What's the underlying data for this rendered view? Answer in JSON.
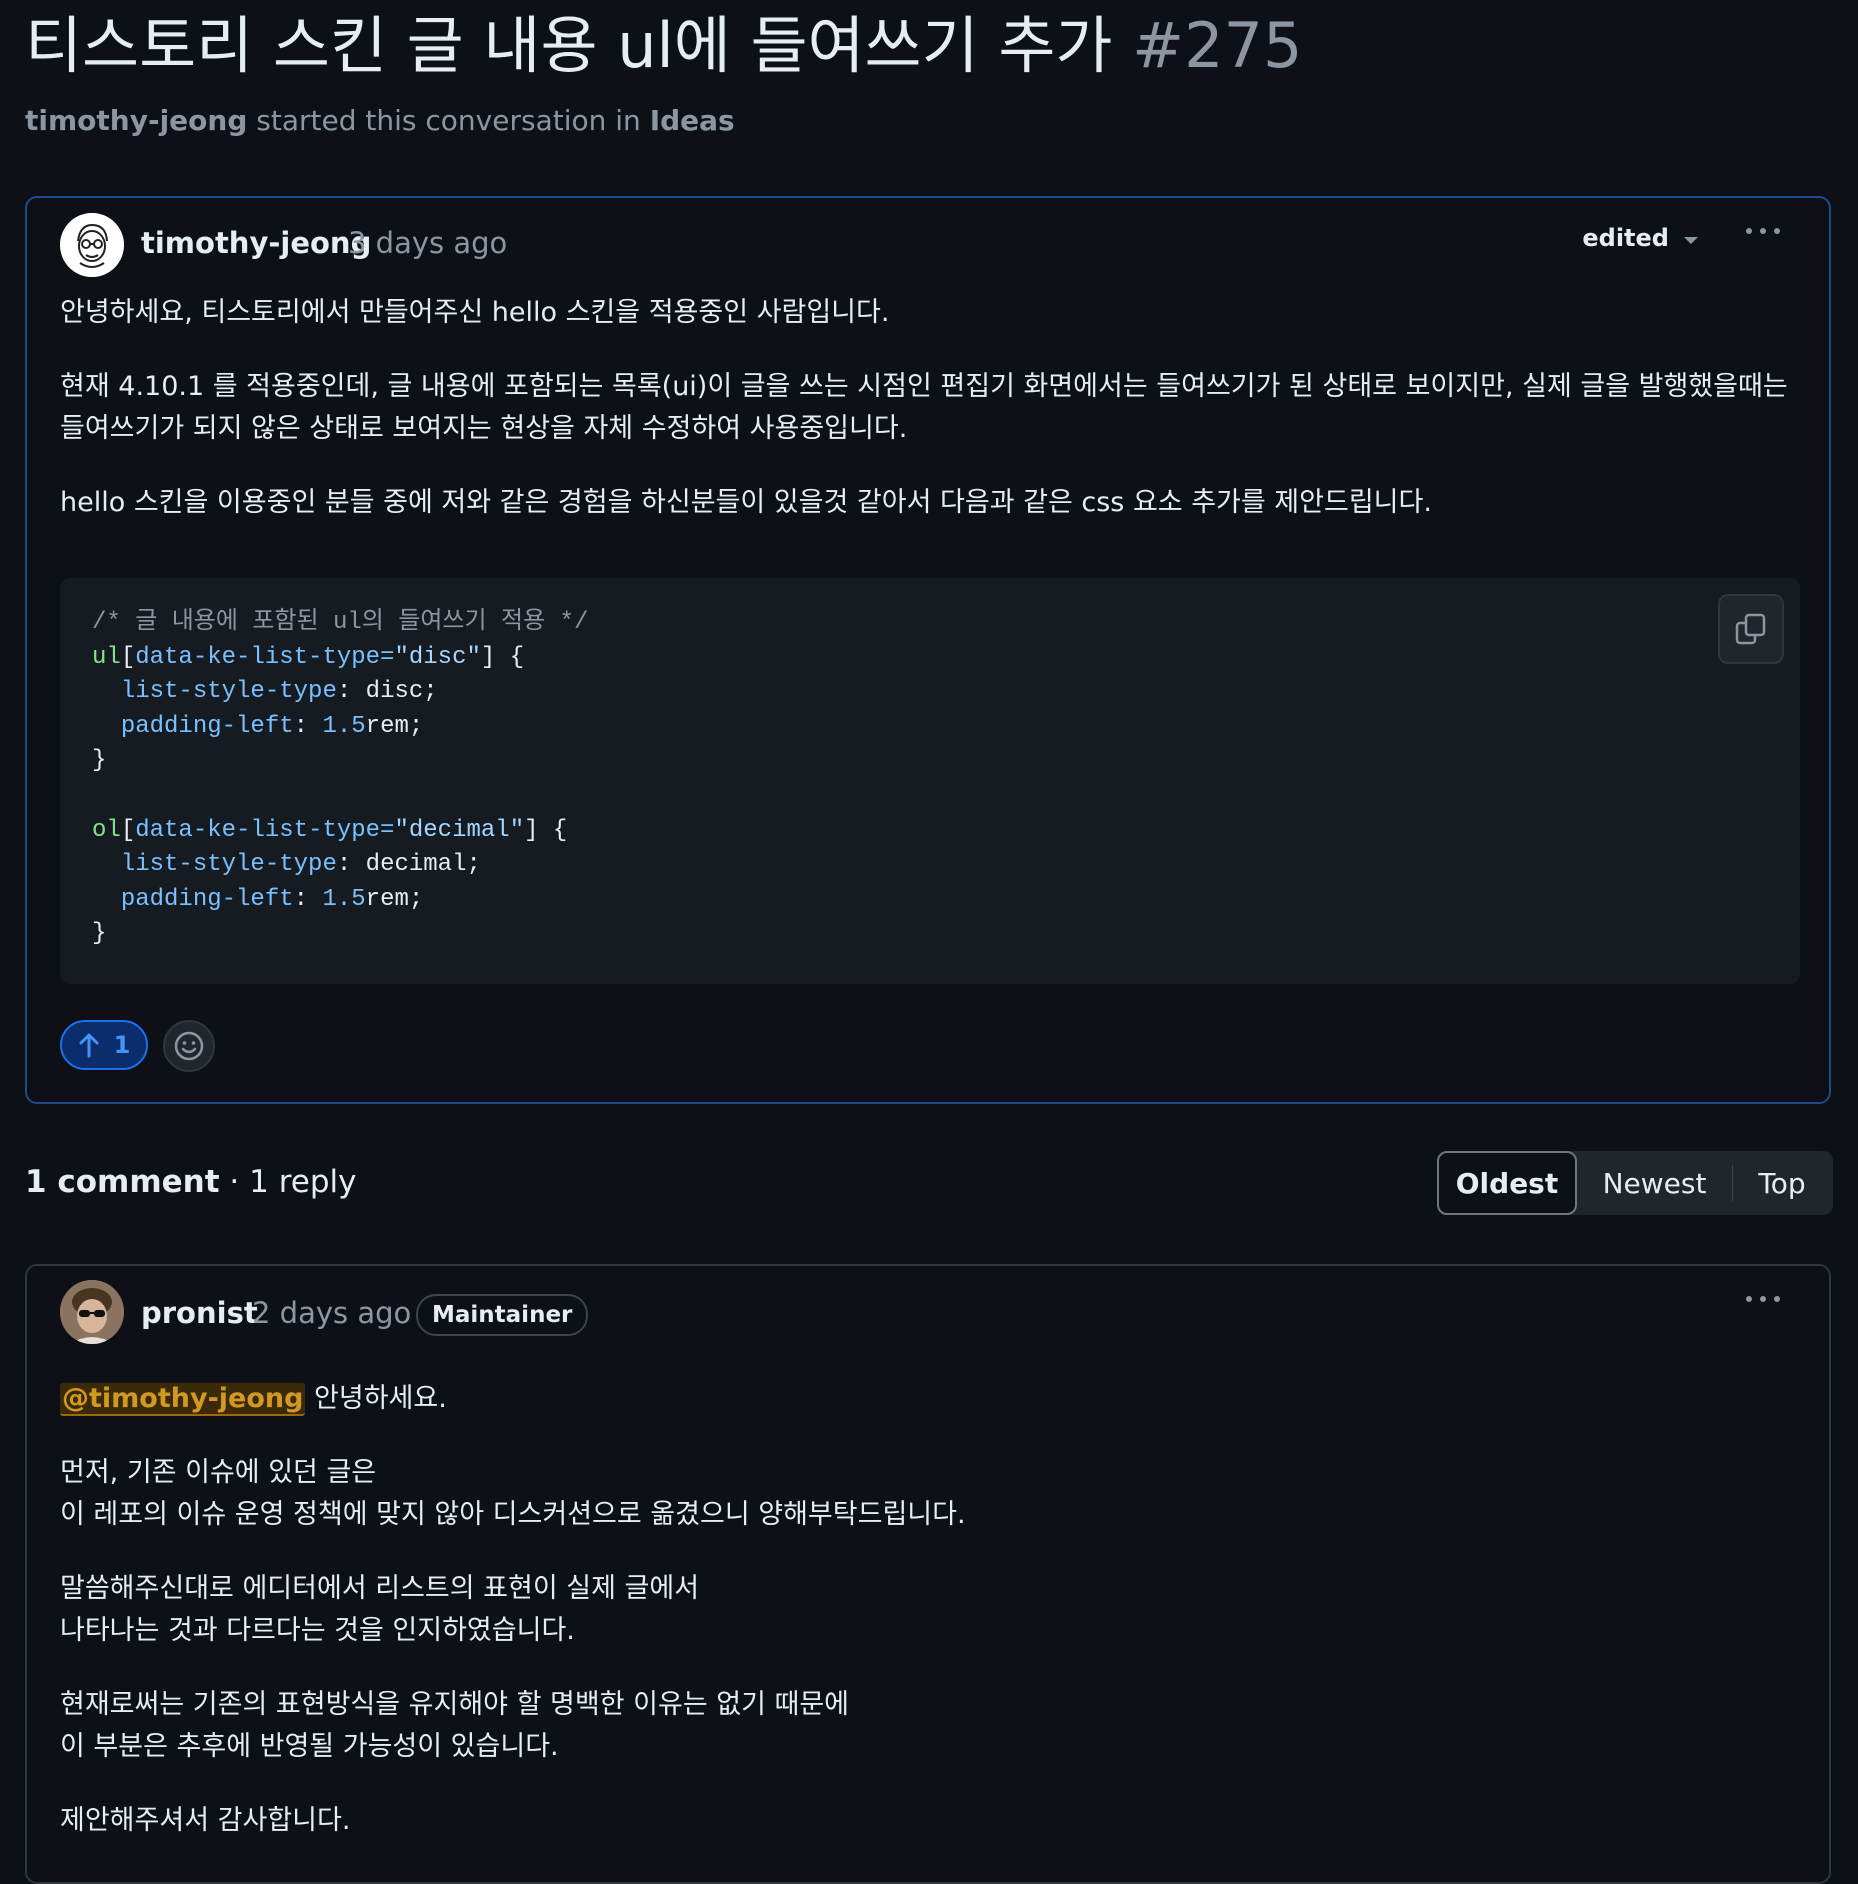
{
  "discussion": {
    "title": "티스토리 스킨 글 내용 ul에 들여쓰기 추가",
    "number": "#275",
    "meta_author": "timothy-jeong",
    "meta_text": " started this conversation in ",
    "meta_category": "Ideas"
  },
  "post": {
    "author": "timothy-jeong",
    "time": "3 days ago",
    "edited_label": "edited",
    "paragraphs": [
      "안녕하세요, 티스토리에서 만들어주신 hello 스킨을 적용중인 사람입니다.",
      "현재 4.10.1 를 적용중인데, 글 내용에 포함되는 목록(ui)이 글을 쓰는 시점인 편집기 화면에서는 들여쓰기가 된 상태로 보이지만, 실제 글을 발행했을때는 들여쓰기가 되지 않은 상태로 보여지는 현상을 자체 수정하여 사용중입니다.",
      "hello 스킨을 이용중인 분들 중에 저와 같은 경험을 하신분들이 있을것 같아서 다음과 같은 css 요소 추가를 제안드립니다."
    ],
    "code": {
      "comment": "/* 글 내용에 포함된 ul의 들여쓰기 적용 */",
      "sel1": "ul",
      "attr1": "data-ke-list-type=",
      "val1": "\"disc\"",
      "prop1a": "list-style-type",
      "val1a": "disc;",
      "prop1b": "padding-left",
      "num1b": "1.5",
      "unit1b": "rem;",
      "sel2": "ol",
      "attr2": "data-ke-list-type=",
      "val2": "\"decimal\"",
      "prop2a": "list-style-type",
      "val2a": "decimal;",
      "prop2b": "padding-left",
      "num2b": "1.5",
      "unit2b": "rem;"
    },
    "upvotes": "1"
  },
  "comments_header": {
    "count_label": "1 comment",
    "reply_label": " · 1 reply"
  },
  "sort": {
    "options": [
      "Oldest",
      "Newest",
      "Top"
    ],
    "active": "Oldest"
  },
  "reply": {
    "author": "pronist",
    "time": "2 days ago",
    "badge": "Maintainer",
    "mention": "@timothy-jeong",
    "greeting": " 안녕하세요.",
    "para1_l1": "먼저, 기존 이슈에 있던 글은",
    "para1_l2": "이 레포의 이슈 운영 정책에 맞지 않아 디스커션으로 옮겼으니 양해부탁드립니다.",
    "para2_l1": "말씀해주신대로 에디터에서 리스트의 표현이 실제 글에서",
    "para2_l2": "나타나는 것과 다르다는 것을 인지하였습니다.",
    "para3_l1": "현재로써는 기존의 표현방식을 유지해야 할 명백한 이유는 없기 때문에",
    "para3_l2": "이 부분은 추후에 반영될 가능성이 있습니다.",
    "para4": "제안해주셔서 감사합니다."
  },
  "icons": {
    "edited_caret": "chevron-down-icon",
    "kebab": "kebab-horizontal-icon",
    "copy": "copy-icon",
    "upvote": "arrow-up-icon",
    "emoji": "smiley-icon"
  },
  "colors": {
    "background": "#0d1117",
    "accent": "#1f6feb",
    "mention": "#d29922"
  }
}
